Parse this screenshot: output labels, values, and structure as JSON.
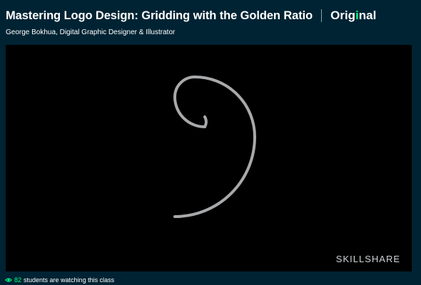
{
  "header": {
    "title": "Mastering Logo Design: Gridding with the Golden Ratio",
    "badge_text_main": "Orig",
    "badge_text_accent": "i",
    "badge_text_tail": "nal",
    "subtitle": "George Bokhua, Digital Graphic Designer & Illustrator"
  },
  "video": {
    "watermark": "SKILLSHARE",
    "stroke_color": "#a7a9ab"
  },
  "footer": {
    "count": "82",
    "text": "students are watching this class"
  },
  "colors": {
    "background": "#002333",
    "accent": "#00ff84",
    "video_bg": "#000000"
  },
  "icons": [
    "eye-icon",
    "golden-spiral-icon"
  ]
}
